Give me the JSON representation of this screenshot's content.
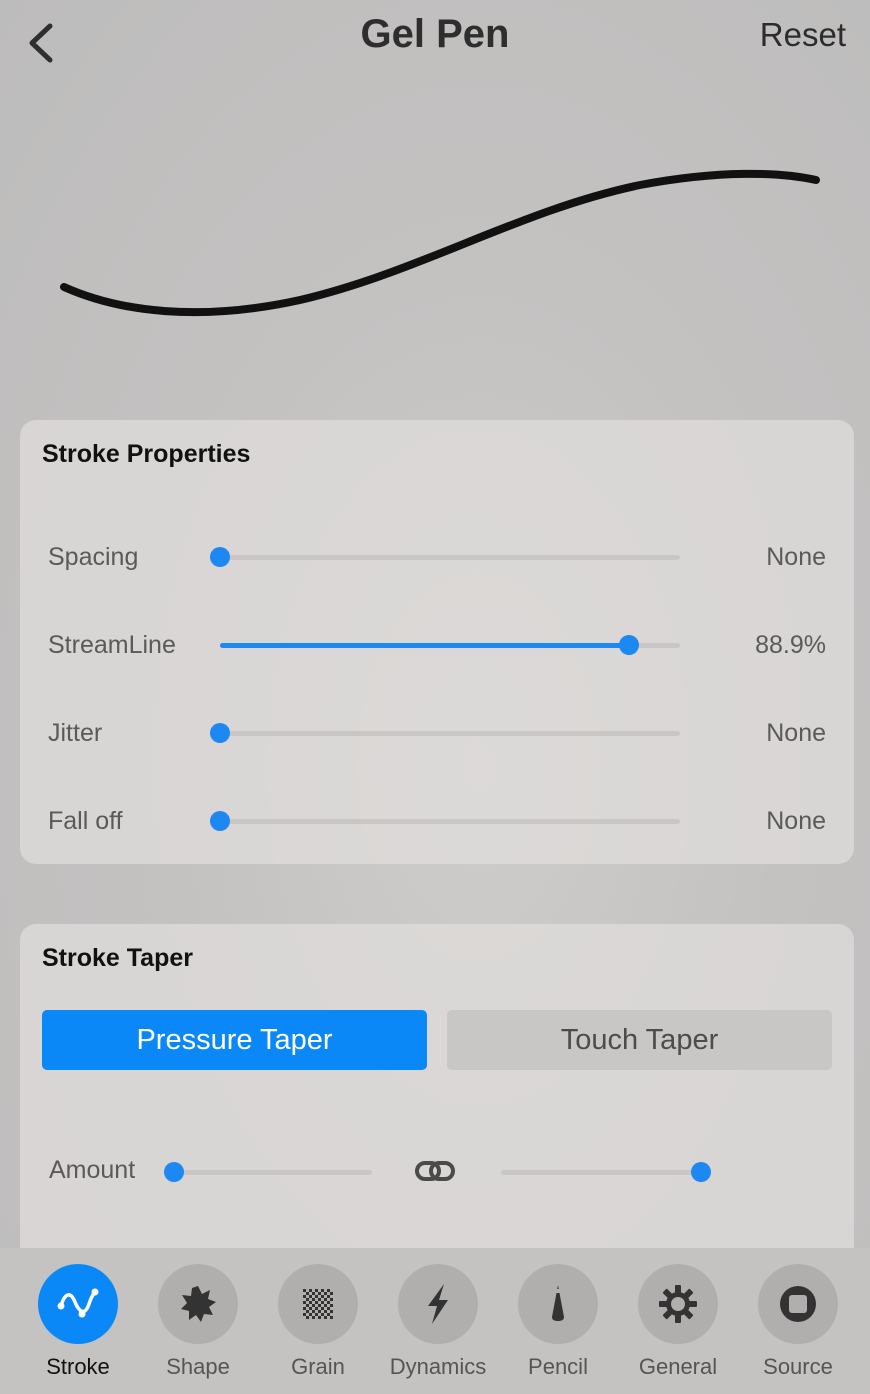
{
  "header": {
    "title": "Gel Pen",
    "reset_label": "Reset"
  },
  "stroke_properties": {
    "title": "Stroke Properties",
    "rows": [
      {
        "label": "Spacing",
        "value": "None",
        "level": 0
      },
      {
        "label": "StreamLine",
        "value": "88.9%",
        "level": 0.889
      },
      {
        "label": "Jitter",
        "value": "None",
        "level": 0
      },
      {
        "label": "Fall off",
        "value": "None",
        "level": 0
      }
    ]
  },
  "stroke_taper": {
    "title": "Stroke Taper",
    "segments": [
      {
        "label": "Pressure Taper",
        "selected": true
      },
      {
        "label": "Touch Taper",
        "selected": false
      }
    ],
    "amount": {
      "label": "Amount",
      "start_level": 0,
      "end_level": 1
    }
  },
  "tabs": [
    {
      "label": "Stroke",
      "icon": "stroke-icon",
      "active": true
    },
    {
      "label": "Shape",
      "icon": "shape-icon",
      "active": false
    },
    {
      "label": "Grain",
      "icon": "grain-icon",
      "active": false
    },
    {
      "label": "Dynamics",
      "icon": "dynamics-icon",
      "active": false
    },
    {
      "label": "Pencil",
      "icon": "pencil-icon",
      "active": false
    },
    {
      "label": "General",
      "icon": "gear-icon",
      "active": false
    },
    {
      "label": "Source",
      "icon": "source-icon",
      "active": false
    }
  ],
  "colors": {
    "accent": "#0a88f8",
    "slider_blue": "#1e88f2",
    "track": "#c9c6c4"
  }
}
